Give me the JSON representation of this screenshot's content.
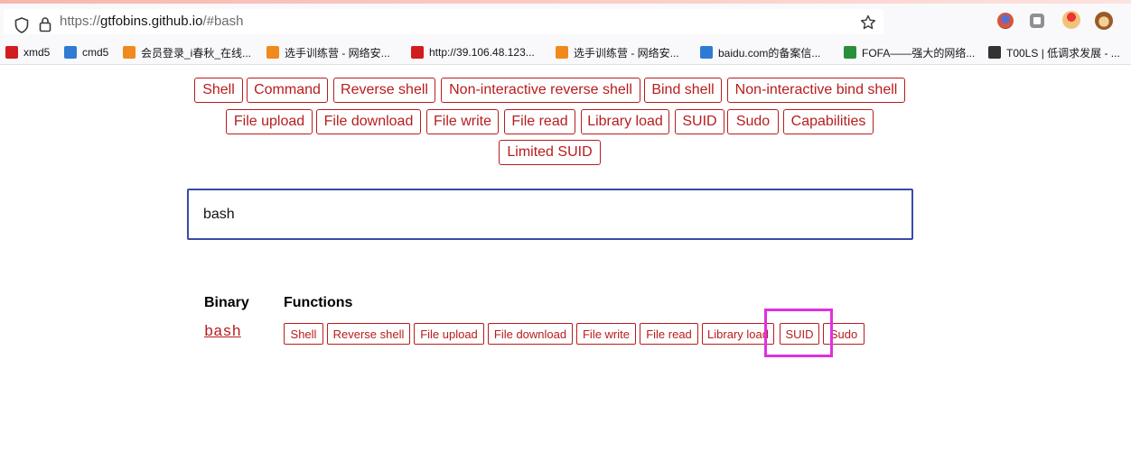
{
  "browser": {
    "url_prefix": "https://",
    "url_host": "gtfobins.github.io",
    "url_path": "/#bash",
    "bookmarks": [
      {
        "label": "xmd5",
        "icon": "x-logo-icon",
        "color": "#d11d1d"
      },
      {
        "label": "cmd5",
        "icon": "cmd5-logo-icon",
        "color": "#2f7bd3"
      },
      {
        "label": "会员登录_i春秋_在线...",
        "icon": "ichunqiu-logo-icon",
        "color": "#f08a1d"
      },
      {
        "label": "选手训练营 - 网络安...",
        "icon": "ichunqiu-logo-icon",
        "color": "#f08a1d"
      },
      {
        "label": "http://39.106.48.123...",
        "icon": "z-logo-icon",
        "color": "#d11d1d"
      },
      {
        "label": "选手训练营 - 网络安...",
        "icon": "ichunqiu-logo-icon",
        "color": "#f08a1d"
      },
      {
        "label": "baidu.com的备案信...",
        "icon": "beian-logo-icon",
        "color": "#2f7bd3"
      },
      {
        "label": "FOFA——强大的网络...",
        "icon": "fofa-logo-icon",
        "color": "#2a8f3a"
      },
      {
        "label": "T00LS | 低调求发展 - ...",
        "icon": "t00ls-logo-icon",
        "color": "#333333"
      }
    ]
  },
  "filters": {
    "row1": [
      "Shell",
      "Command",
      "Reverse shell",
      "Non-interactive reverse shell",
      "Bind shell",
      "Non-interactive bind shell"
    ],
    "row2": [
      "File upload",
      "File download",
      "File write",
      "File read",
      "Library load",
      "SUID",
      "Sudo",
      "Capabilities"
    ],
    "row3": [
      "Limited SUID"
    ]
  },
  "search": {
    "value": "bash"
  },
  "results": {
    "header_binary": "Binary",
    "header_functions": "Functions",
    "rows": [
      {
        "binary": "bash",
        "functions": [
          "Shell",
          "Reverse shell",
          "File upload",
          "File download",
          "File write",
          "File read",
          "Library load",
          "SUID",
          "Sudo"
        ],
        "highlighted_function": "SUID"
      }
    ]
  },
  "colors": {
    "accent": "#b91c1c",
    "search_border": "#3b4aa7",
    "highlight": "#e030e0"
  }
}
